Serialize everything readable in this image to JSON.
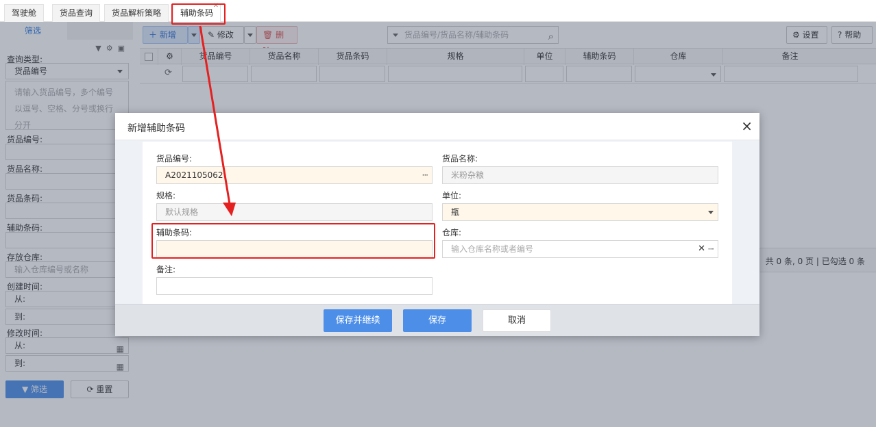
{
  "tabs": [
    {
      "label": "驾驶舱"
    },
    {
      "label": "货品查询"
    },
    {
      "label": "货品解析策略"
    },
    {
      "label": "辅助条码",
      "active": true
    }
  ],
  "left_panel": {
    "tab": "筛选",
    "query_type_label": "查询类型:",
    "query_type_value": "货品编号",
    "query_textarea_placeholder_lines": [
      "请输入货品编号，多个编号",
      "以逗号、空格、分号或换行",
      "分开"
    ],
    "goods_code_label": "货品编号:",
    "goods_name_label": "货品名称:",
    "goods_barcode_label": "货品条码:",
    "aux_barcode_label": "辅助条码:",
    "warehouse_label": "存放仓库:",
    "warehouse_placeholder": "输入仓库编号或名称",
    "created_label": "创建时间:",
    "modified_label": "修改时间:",
    "from_label": "从:",
    "to_label": "到:",
    "filter_button": "筛选",
    "reset_button": "重置"
  },
  "toolbar": {
    "add": "新增",
    "edit": "修改",
    "delete": "删除",
    "search_placeholder": "货品编号/货品名称/辅助条码",
    "settings": "设置",
    "help": "帮助"
  },
  "grid": {
    "columns": [
      "货品编号",
      "货品名称",
      "货品条码",
      "规格",
      "单位",
      "辅助条码",
      "仓库",
      "备注"
    ],
    "pager": "共 0 条, 0 页 | 已勾选 0 条"
  },
  "modal": {
    "title": "新增辅助条码",
    "close": "×",
    "fields": {
      "goods_code_label": "货品编号:",
      "goods_code_value": "A2021105062",
      "goods_name_label": "货品名称:",
      "goods_name_value": "米粉杂粮",
      "spec_label": "规格:",
      "spec_value": "默认规格",
      "unit_label": "单位:",
      "unit_value": "瓶",
      "aux_barcode_label": "辅助条码:",
      "aux_barcode_value": "",
      "warehouse_label": "仓库:",
      "warehouse_placeholder": "输入仓库名称或者编号",
      "remark_label": "备注:",
      "remark_value": ""
    },
    "buttons": {
      "save_continue": "保存并继续",
      "save": "保存",
      "cancel": "取消"
    }
  },
  "colors": {
    "primary": "#4d8fe8",
    "highlight": "#e52020",
    "required_bg": "#fff7ea"
  }
}
